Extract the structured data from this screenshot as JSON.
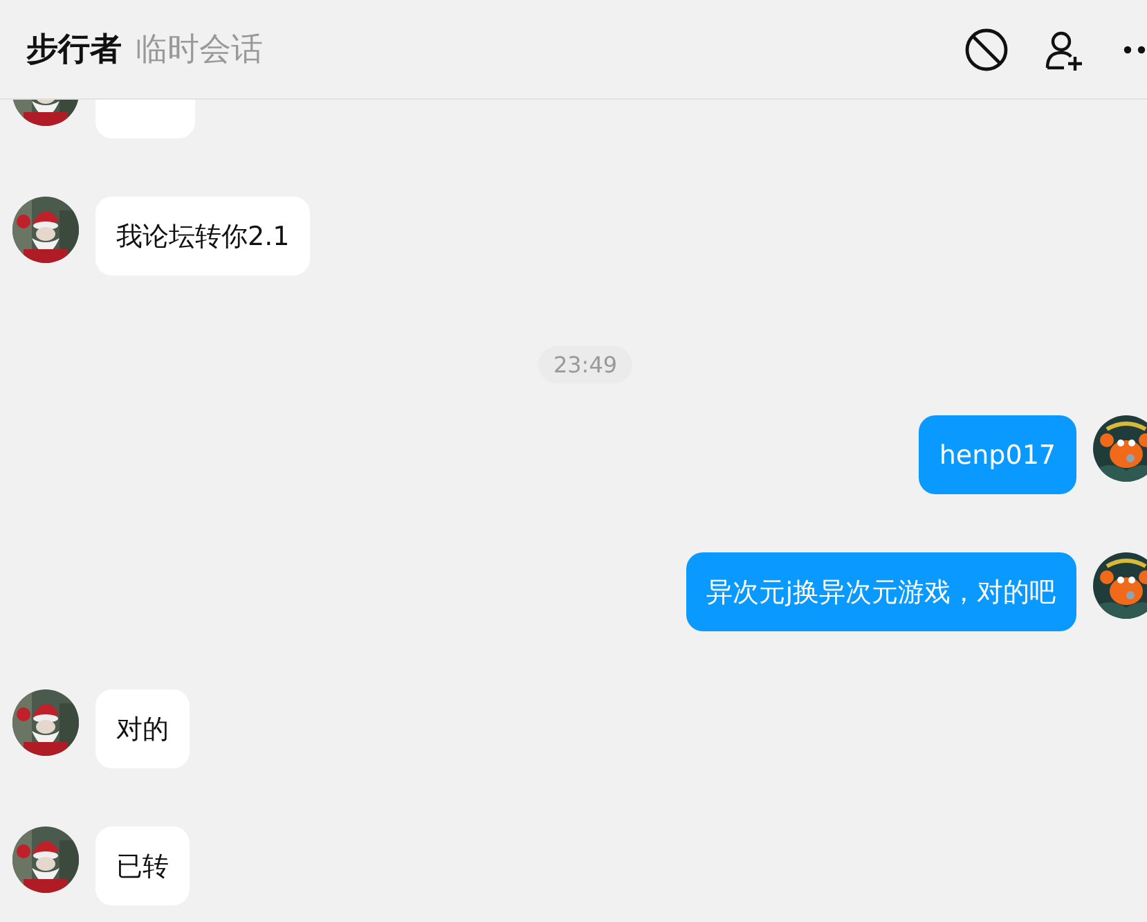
{
  "header": {
    "title": "步行者",
    "subtitle": "临时会话"
  },
  "messages": [
    {
      "kind": "cut",
      "mine": false
    },
    {
      "kind": "text",
      "mine": false,
      "text": "我论坛转你2.1"
    },
    {
      "kind": "time",
      "text": "23:49"
    },
    {
      "kind": "text",
      "mine": true,
      "text": "henp017"
    },
    {
      "kind": "text",
      "mine": true,
      "text": "异次元j换异次元游戏，对的吧"
    },
    {
      "kind": "text",
      "mine": false,
      "text": "对的"
    },
    {
      "kind": "text",
      "mine": false,
      "text": "已转"
    }
  ]
}
